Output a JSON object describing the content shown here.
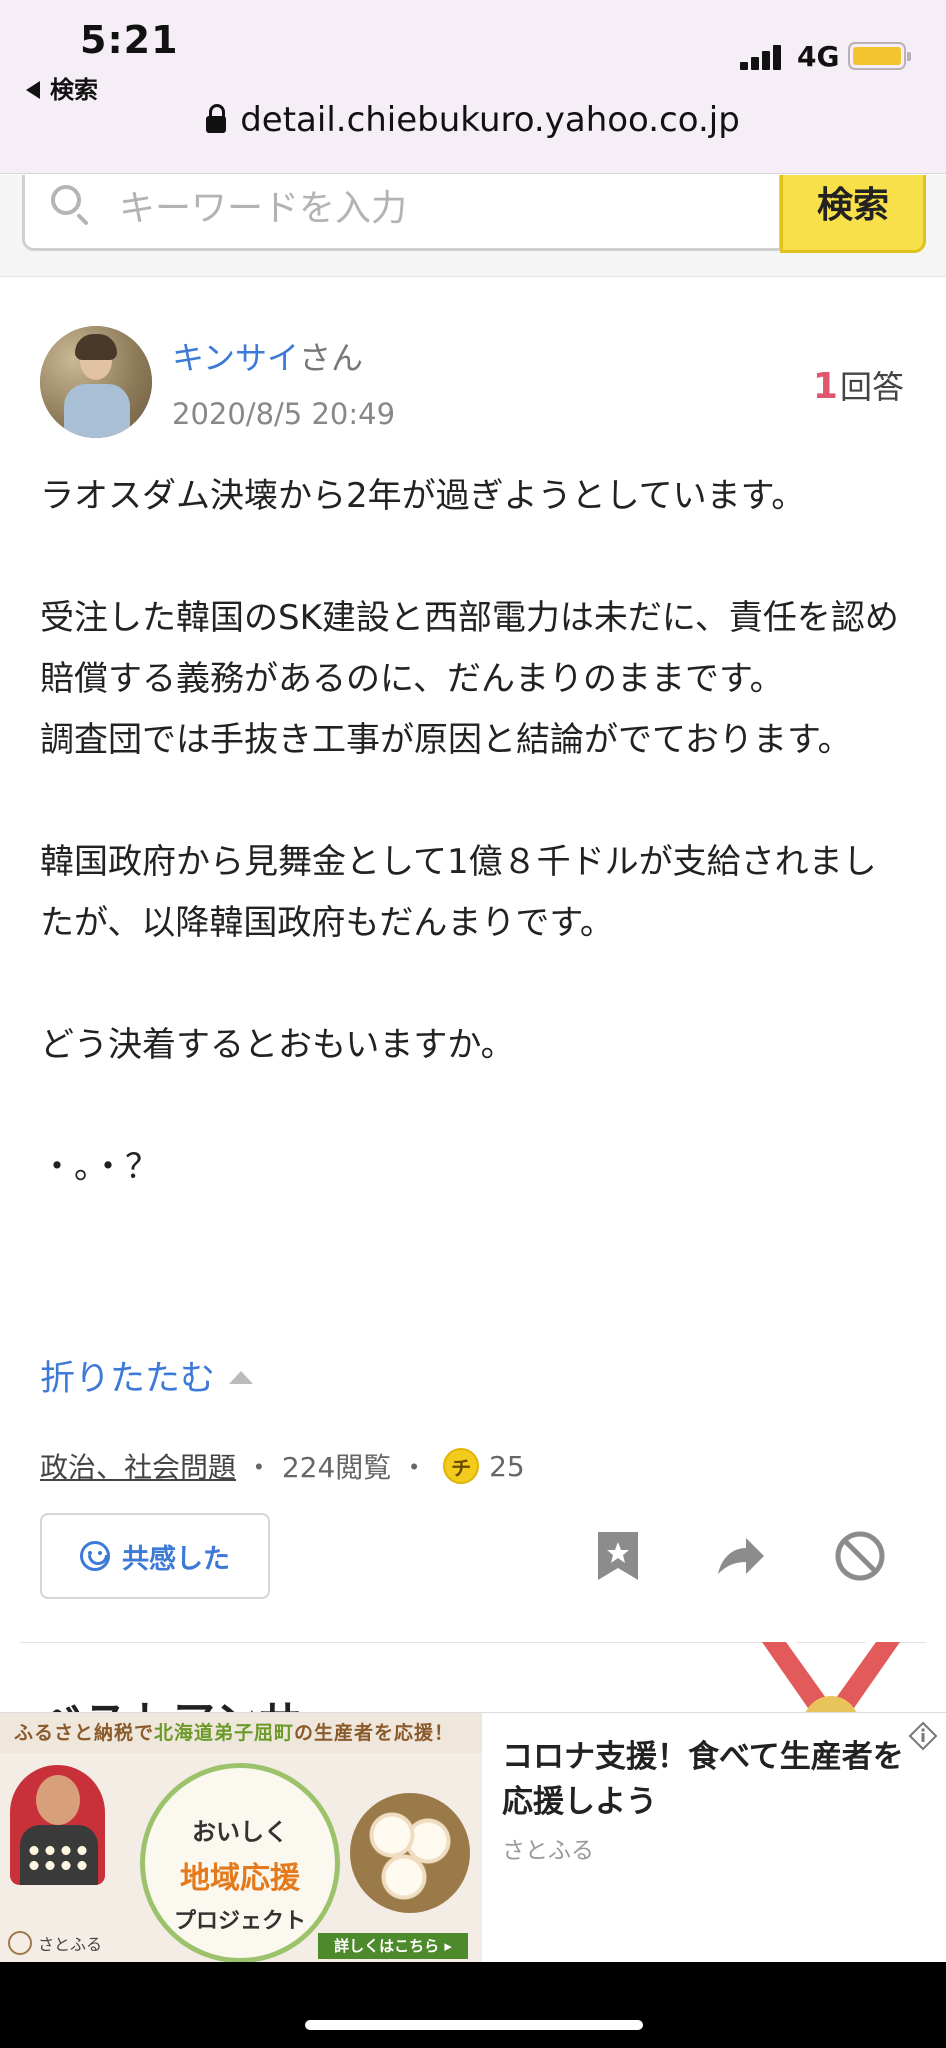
{
  "status_bar": {
    "time": "5:21",
    "back_label": "検索",
    "network": "4G",
    "battery_color": "#f4c430"
  },
  "browser": {
    "url": "detail.chiebukuro.yahoo.co.jp"
  },
  "search": {
    "placeholder": "キーワードを入力",
    "button_label": "検索",
    "button_color": "#f8e04a"
  },
  "question": {
    "user_name": "キンサイ",
    "user_suffix": "さん",
    "date": "2020/8/5 20:49",
    "answer_count": "1",
    "answer_label": "回答",
    "paragraphs": [
      "ラオスダム決壊から2年が過ぎようとしています。",
      "",
      "受注した韓国のSK建設と西部電力は未だに、責任を認め賠償する義務があるのに、だんまりのままです。",
      "調査団では手抜き工事が原因と結論がでております。",
      "",
      "韓国政府から見舞金として1億８千ドルが支給されましたが、以降韓国政府もだんまりです。",
      "",
      "どう決着するとおもいますか。",
      "",
      "・。・？"
    ],
    "fold_label": "折りたたむ",
    "category": "政治、社会問題",
    "views": "224閲覧",
    "coin_label": "チ",
    "coins": "25",
    "empathy_label": "共感した"
  },
  "icons": {
    "bookmark": "bookmark-icon",
    "share": "share-icon",
    "block": "block-icon"
  },
  "best_answer": {
    "heading": "ベストアンサー"
  },
  "ad": {
    "banner_text_pre": "ふるさと納税で",
    "banner_text_hl": "北海道弟子屈町",
    "banner_text_post": "の生産者を応援！",
    "circle_line1": "おいしく",
    "circle_line2": "地域応援",
    "circle_line3": "プロジェクト",
    "more_label": "詳しくはこちら ▸",
    "logo_label": "さとふる",
    "title": "コロナ支援！食べて生産者を応援しよう",
    "sponsor": "さとふる"
  },
  "colors": {
    "link_blue": "#3d79d6",
    "answer_count_red": "#e0566e",
    "topbar_bg": "#f6eef7"
  }
}
